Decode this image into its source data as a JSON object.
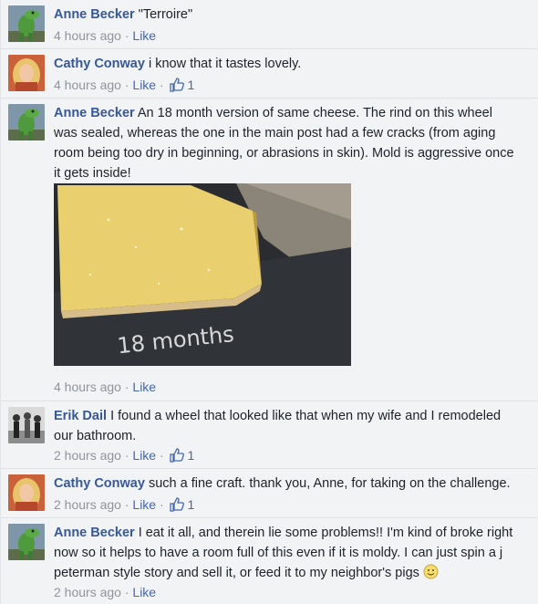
{
  "comments": [
    {
      "author": "Anne Becker",
      "text": "\"Terroire\"",
      "time": "4 hours ago",
      "like_label": "Like",
      "avatar_icon": "dinosaur-avatar"
    },
    {
      "author": "Cathy Conway",
      "text": "i know that it tastes lovely.",
      "time": "4 hours ago",
      "like_label": "Like",
      "likes": "1",
      "avatar_icon": "blonde-woman-avatar"
    },
    {
      "author": "Anne Becker",
      "text": "An 18 month version of same cheese. The rind on this wheel was sealed, whereas the one in the main post had a few cracks (from aging room being too dry in beginning, or abrasions in skin). Mold is aggressive once it gets inside!",
      "time": "4 hours ago",
      "like_label": "Like",
      "avatar_icon": "dinosaur-avatar",
      "photo_chalk_text": "18 months",
      "photo_icon": "cheese-wedge-photo"
    },
    {
      "author": "Erik Dail",
      "text": "I found a wheel that looked like that when my wife and I remodeled our bathroom.",
      "time": "2 hours ago",
      "like_label": "Like",
      "likes": "1",
      "avatar_icon": "group-photo-avatar"
    },
    {
      "author": "Cathy Conway",
      "text": "such a fine craft. thank you, Anne, for taking on the challenge.",
      "time": "2 hours ago",
      "like_label": "Like",
      "likes": "1",
      "avatar_icon": "blonde-woman-avatar"
    },
    {
      "author": "Anne Becker",
      "text": "I eat it all, and therein lie some problems!! I'm kind of broke right now so it helps to have a room full of this even if it is moldy. I can just spin a j peterman style story and sell it, or feed it to my neighbor's pigs",
      "time": "2 hours ago",
      "like_label": "Like",
      "avatar_icon": "dinosaur-avatar",
      "emoji": "smiley-emoji"
    }
  ],
  "separator": " · ",
  "colors": {
    "name": "#365899",
    "link": "#4267b2",
    "meta": "#90949c",
    "background": "#f2f3f5"
  }
}
